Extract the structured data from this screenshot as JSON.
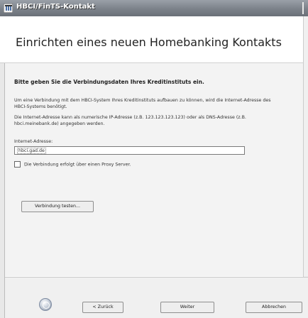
{
  "window": {
    "title": "HBCI/FinTS-Kontakt"
  },
  "header": {
    "title": "Einrichten eines neuen Homebanking Kontakts"
  },
  "main": {
    "instruction": "Bitte geben Sie die Verbindungsdaten Ihres Kreditinstituts ein.",
    "paragraph1": "Um eine Verbindung mit dem HBCI-System Ihres Kreditinstituts aufbauen zu können, wird die Internet-Adresse des HBCI-Systems benötigt.",
    "paragraph2": "Die Internet-Adresse kann als numerische IP-Adresse (z.B. 123.123.123.123) oder als DNS-Adresse (z.B. hbci.meinebank.de) angegeben werden.",
    "address_label": "Internet-Adresse:",
    "address_value": "hbci.gad.de",
    "proxy_label": "Die Verbindung erfolgt über einen Proxy Server.",
    "proxy_checked": false,
    "test_button": "Verbindung testen..."
  },
  "footer": {
    "back": "< Zurück",
    "next": "Weiter",
    "cancel": "Abbrechen"
  },
  "icons": {
    "app": "bank-icon",
    "help": "help-icon"
  }
}
